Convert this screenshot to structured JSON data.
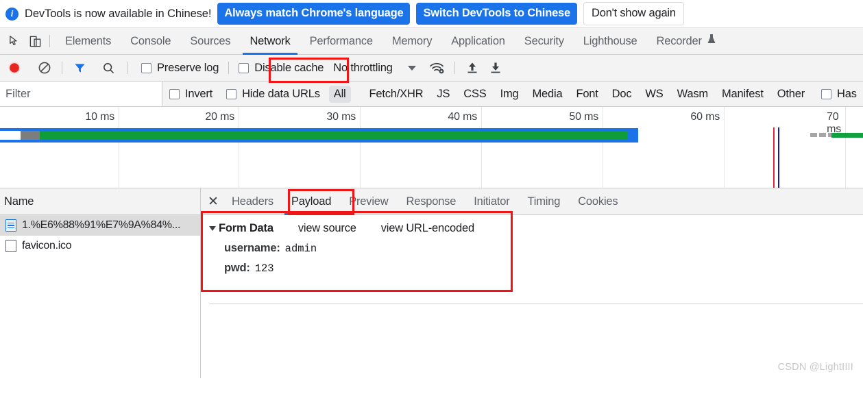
{
  "banner": {
    "icon": "info-icon",
    "message": "DevTools is now available in Chinese!",
    "primary_button": "Always match Chrome's language",
    "secondary_button": "Switch DevTools to Chinese",
    "dismiss_button": "Don't show again",
    "accent_color": "#1a73e8"
  },
  "panel_tabs": {
    "inspect_icon": "inspect-cursor-icon",
    "device_icon": "device-toolbar-icon",
    "items": [
      {
        "label": "Elements",
        "active": false
      },
      {
        "label": "Console",
        "active": false
      },
      {
        "label": "Sources",
        "active": false
      },
      {
        "label": "Network",
        "active": true
      },
      {
        "label": "Performance",
        "active": false
      },
      {
        "label": "Memory",
        "active": false
      },
      {
        "label": "Application",
        "active": false
      },
      {
        "label": "Security",
        "active": false
      },
      {
        "label": "Lighthouse",
        "active": false
      },
      {
        "label": "Recorder",
        "active": false,
        "icon": "experiment-flask-icon"
      }
    ],
    "highlight_color": "#f11515",
    "active_underline_color": "#1a73e8"
  },
  "network_toolbar": {
    "record_icon": "record-button-icon",
    "clear_icon": "clear-network-icon",
    "filter_icon": "filter-funnel-icon",
    "search_icon": "search-icon",
    "preserve_log": {
      "label": "Preserve log",
      "checked": false
    },
    "disable_cache": {
      "label": "Disable cache",
      "checked": false
    },
    "throttling": {
      "value": "No throttling",
      "caret": "chevron-down-icon"
    },
    "network_conditions_icon": "wifi-settings-icon",
    "import_icon": "import-har-icon",
    "export_icon": "export-har-icon"
  },
  "filter_bar": {
    "filter_placeholder": "Filter",
    "filter_value": "",
    "invert": {
      "label": "Invert",
      "checked": false
    },
    "hide_data_urls": {
      "label": "Hide data URLs",
      "checked": false
    },
    "types": [
      {
        "label": "All",
        "selected": true
      },
      {
        "label": "Fetch/XHR",
        "selected": false
      },
      {
        "label": "JS",
        "selected": false
      },
      {
        "label": "CSS",
        "selected": false
      },
      {
        "label": "Img",
        "selected": false
      },
      {
        "label": "Media",
        "selected": false
      },
      {
        "label": "Font",
        "selected": false
      },
      {
        "label": "Doc",
        "selected": false
      },
      {
        "label": "WS",
        "selected": false
      },
      {
        "label": "Wasm",
        "selected": false
      },
      {
        "label": "Manifest",
        "selected": false
      },
      {
        "label": "Other",
        "selected": false
      }
    ],
    "has_blocked_cookies": {
      "label": "Has",
      "checked": false
    }
  },
  "overview": {
    "ticks": [
      "10 ms",
      "20 ms",
      "30 ms",
      "40 ms",
      "50 ms",
      "60 ms",
      "70 ms"
    ],
    "bar_colors": {
      "outline": "#1a73e8",
      "content": "#0f9d3a",
      "queue": "#7d7d7d",
      "stalled": "#a6a6a6"
    },
    "markers": {
      "dom_content_loaded": "#e32636",
      "load": "#1a1aa8"
    }
  },
  "request_list": {
    "column_header": "Name",
    "rows": [
      {
        "name": "1.%E6%88%91%E7%9A%84%...",
        "icon": "document-icon",
        "selected": true
      },
      {
        "name": "favicon.ico",
        "icon": "blank-file-icon",
        "selected": false
      }
    ]
  },
  "detail_tabs": {
    "close_icon": "close-icon",
    "items": [
      {
        "label": "Headers",
        "active": false
      },
      {
        "label": "Payload",
        "active": true
      },
      {
        "label": "Preview",
        "active": false
      },
      {
        "label": "Response",
        "active": false
      },
      {
        "label": "Initiator",
        "active": false
      },
      {
        "label": "Timing",
        "active": false
      },
      {
        "label": "Cookies",
        "active": false
      }
    ]
  },
  "payload": {
    "section_title": "Form Data",
    "toggle_icon": "triangle-expanded-icon",
    "view_source": "view source",
    "view_url_encoded": "view URL-encoded",
    "fields": [
      {
        "key": "username:",
        "value": "admin"
      },
      {
        "key": "pwd:",
        "value": "123"
      }
    ]
  },
  "watermark": "CSDN @LightIIII"
}
